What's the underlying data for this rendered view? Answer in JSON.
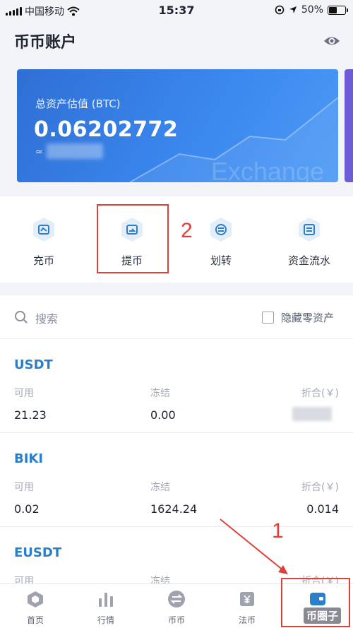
{
  "status_bar": {
    "carrier": "中国移动",
    "time": "15:37",
    "battery": "50%"
  },
  "header": {
    "title": "币币账户",
    "eye_icon": "eye-icon"
  },
  "asset_card": {
    "label": "总资产估值 (BTC)",
    "value": "0.06202772",
    "approx_prefix": "≈",
    "watermark": "Exchange"
  },
  "actions": [
    {
      "label": "充币",
      "icon": "deposit-icon"
    },
    {
      "label": "提币",
      "icon": "withdraw-icon"
    },
    {
      "label": "划转",
      "icon": "transfer-icon"
    },
    {
      "label": "资金流水",
      "icon": "ledger-icon"
    }
  ],
  "annotations": {
    "step2": "2",
    "step1": "1"
  },
  "search": {
    "label": "搜索",
    "hide_zero": "隐藏零资产"
  },
  "coins": [
    {
      "name": "USDT",
      "available_label": "可用",
      "frozen_label": "冻结",
      "converted_label": "折合(￥)",
      "available": "21.23",
      "frozen": "0.00",
      "converted": ""
    },
    {
      "name": "BIKI",
      "available_label": "可用",
      "frozen_label": "冻结",
      "converted_label": "折合(￥)",
      "available": "0.02",
      "frozen": "1624.24",
      "converted": "0.014"
    },
    {
      "name": "EUSDT",
      "available_label": "可用",
      "frozen_label": "冻结",
      "converted_label": "折合(￥)",
      "available": "",
      "frozen": "",
      "converted": ""
    }
  ],
  "tabs": [
    {
      "label": "首页",
      "icon": "home-icon"
    },
    {
      "label": "行情",
      "icon": "market-icon"
    },
    {
      "label": "币币",
      "icon": "exchange-icon"
    },
    {
      "label": "法币",
      "icon": "fiat-icon"
    },
    {
      "label": "",
      "icon": "wallet-icon"
    }
  ],
  "stamp": "币圈子",
  "colors": {
    "accent": "#2b7ec9",
    "card_start": "#2f6fd4",
    "card_end": "#4c9af5",
    "annotation": "#e0403a"
  }
}
